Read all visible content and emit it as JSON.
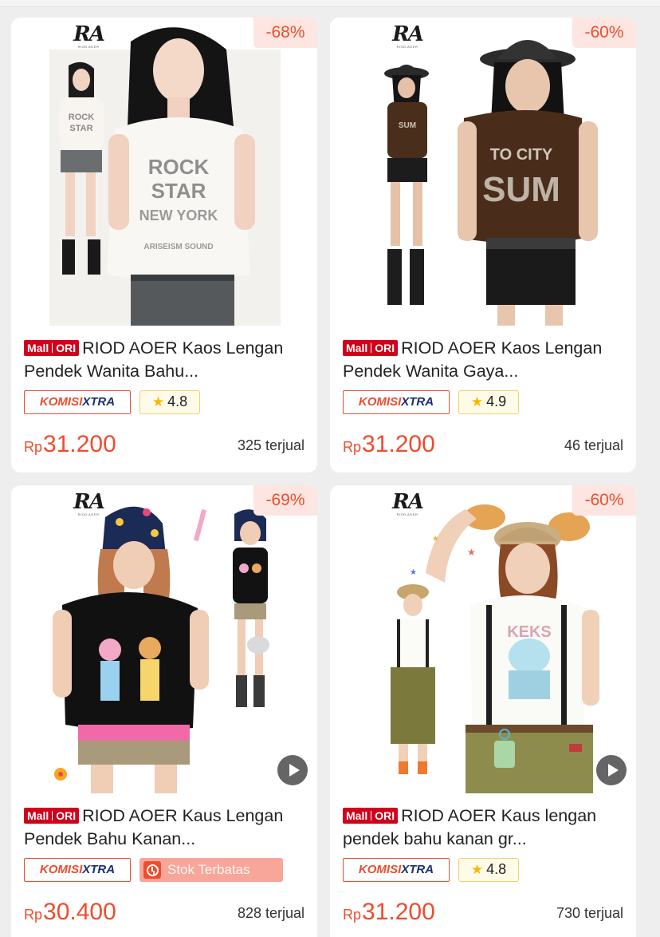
{
  "products": [
    {
      "discount": "-68%",
      "mall_label": "Mall",
      "ori_label": "ORI",
      "title": "RIOD AOER Kaos Lengan Pendek Wanita Bahu...",
      "komisi_a": "KOMISI",
      "komisi_b": "XTRA",
      "rating": "4.8",
      "currency": "Rp",
      "price": "31.200",
      "sold": "325 terjual",
      "shirt_print": "ROCK STAR NEW YORK",
      "has_video": false
    },
    {
      "discount": "-60%",
      "mall_label": "Mall",
      "ori_label": "ORI",
      "title": "RIOD AOER Kaos Lengan Pendek Wanita Gaya...",
      "komisi_a": "KOMISI",
      "komisi_b": "XTRA",
      "rating": "4.9",
      "currency": "Rp",
      "price": "31.200",
      "sold": "46 terjual",
      "has_video": false
    },
    {
      "discount": "-69%",
      "mall_label": "Mall",
      "ori_label": "ORI",
      "title": "RIOD AOER Kaus Lengan Pendek Bahu Kanan...",
      "komisi_a": "KOMISI",
      "komisi_b": "XTRA",
      "stock_label": "Stok Terbatas",
      "currency": "Rp",
      "price": "30.400",
      "sold": "828 terjual",
      "has_video": true
    },
    {
      "discount": "-60%",
      "mall_label": "Mall",
      "ori_label": "ORI",
      "title": "RIOD AOER Kaus lengan pendek bahu kanan gr...",
      "komisi_a": "KOMISI",
      "komisi_b": "XTRA",
      "rating": "4.8",
      "currency": "Rp",
      "price": "31.200",
      "sold": "730 terjual",
      "has_video": true
    }
  ],
  "brand": {
    "logo": "RA",
    "tagline": "RIOD AOER"
  },
  "colors": {
    "accent": "#ee4d2d",
    "mall_red": "#d0011b",
    "xtra_navy": "#1a2f73",
    "rating_bg": "#fffbe9",
    "stock_bg": "#f9a69a"
  },
  "icons": {
    "star": "star-icon",
    "play": "play-icon",
    "clock": "alarm-clock-icon"
  }
}
